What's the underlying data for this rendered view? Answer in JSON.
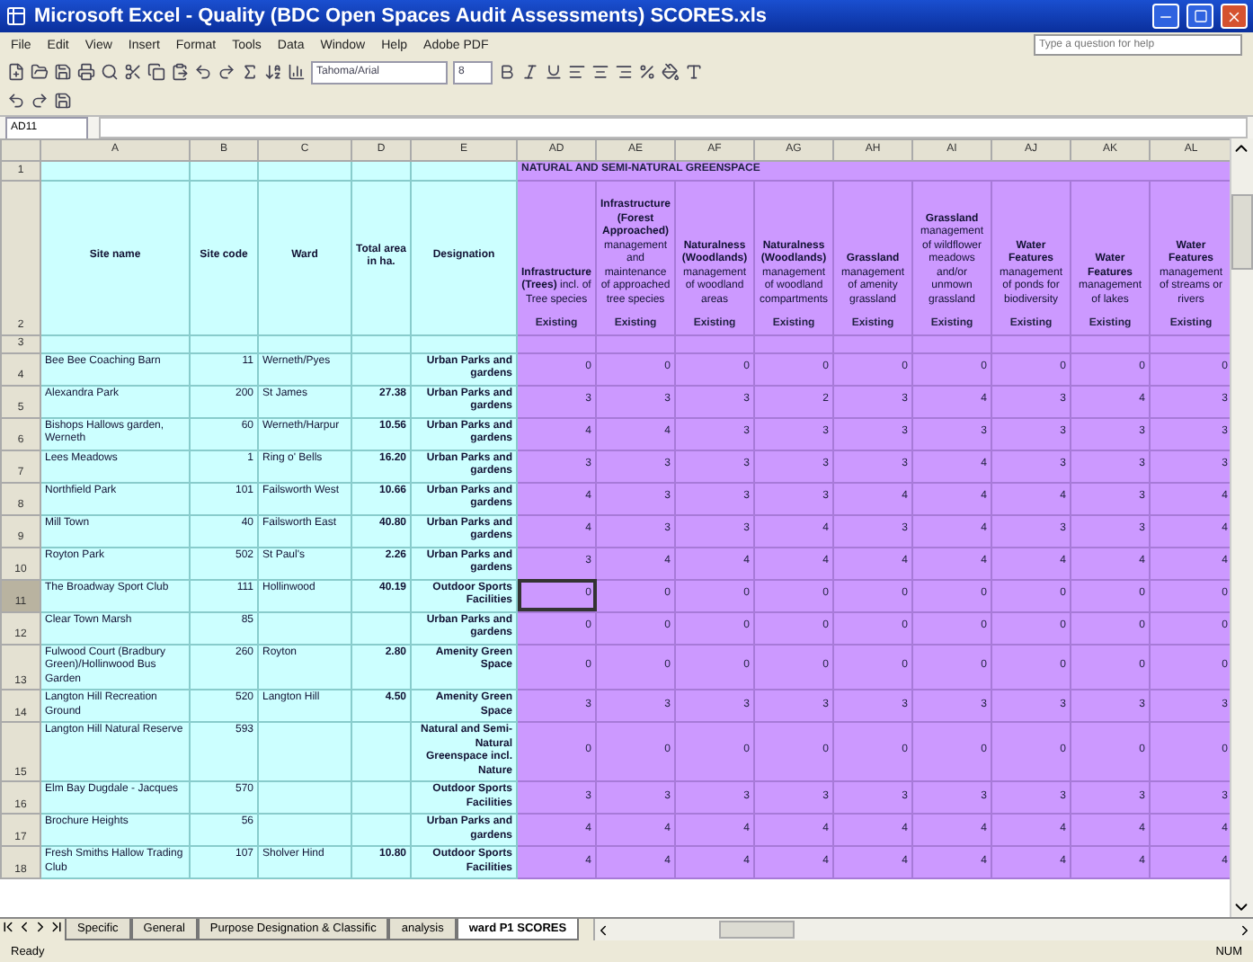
{
  "window": {
    "title": "Microsoft Excel - Quality (BDC Open Spaces Audit Assessments) SCORES.xls"
  },
  "menu": [
    "File",
    "Edit",
    "View",
    "Insert",
    "Format",
    "Tools",
    "Data",
    "Window",
    "Help",
    "Adobe PDF"
  ],
  "help_search": {
    "placeholder": "Type a question for help"
  },
  "font_box": {
    "value": "Tahoma/Arial"
  },
  "size_box": {
    "value": "8"
  },
  "name_box": {
    "value": "AD11"
  },
  "column_letters": [
    "A",
    "B",
    "C",
    "D",
    "E",
    "AD",
    "AE",
    "AF",
    "AG",
    "AH",
    "AI",
    "AJ",
    "AK",
    "AL"
  ],
  "header_row_numbers": [
    "1",
    "2",
    "3"
  ],
  "banner": "NATURAL AND SEMI-NATURAL GREENSPACE",
  "left_headers": [
    "Site name",
    "Site code",
    "Ward",
    "Total area in ha.",
    "Designation"
  ],
  "score_headers": [
    {
      "text": "**Infrastructure (Trees)** incl. of Tree species",
      "sub": "Existing"
    },
    {
      "text": "**Infrastructure (Forest Approached)** management and maintenance of approached tree species",
      "sub": "Existing"
    },
    {
      "text": "**Naturalness (Woodlands)** management of woodland areas",
      "sub": "Existing"
    },
    {
      "text": "**Naturalness (Woodlands)** management of woodland compartments",
      "sub": "Existing"
    },
    {
      "text": "**Grassland** management of amenity grassland",
      "sub": "Existing"
    },
    {
      "text": "**Grassland** management of wildflower meadows and/or unmown grassland",
      "sub": "Existing"
    },
    {
      "text": "**Water Features** management of ponds for biodiversity",
      "sub": "Existing"
    },
    {
      "text": "**Water Features** management of lakes",
      "sub": "Existing"
    },
    {
      "text": "**Water Features** management of streams or rivers",
      "sub": "Existing"
    }
  ],
  "rows": [
    {
      "number": "4",
      "site": "Bee Bee Coaching Barn",
      "code": "11",
      "ward": "Werneth/Pyes",
      "area": "",
      "designation": "Urban Parks and gardens",
      "selected": false,
      "scores": [
        "0",
        "0",
        "0",
        "0",
        "0",
        "0",
        "0",
        "0",
        "0"
      ]
    },
    {
      "number": "5",
      "site": "Alexandra Park",
      "code": "200",
      "ward": "St James",
      "area": "27.38",
      "designation": "Urban Parks and gardens",
      "selected": false,
      "scores": [
        "3",
        "3",
        "3",
        "2",
        "3",
        "4",
        "3",
        "4",
        "3"
      ]
    },
    {
      "number": "6",
      "site": "Bishops Hallows garden, Werneth",
      "code": "60",
      "ward": "Werneth/Harpur",
      "area": "10.56",
      "designation": "Urban Parks and gardens",
      "selected": false,
      "scores": [
        "4",
        "4",
        "3",
        "3",
        "3",
        "3",
        "3",
        "3",
        "3"
      ]
    },
    {
      "number": "7",
      "site": "Lees Meadows",
      "code": "1",
      "ward": "Ring o' Bells",
      "area": "16.20",
      "designation": "Urban Parks and gardens",
      "selected": false,
      "scores": [
        "3",
        "3",
        "3",
        "3",
        "3",
        "4",
        "3",
        "3",
        "3"
      ]
    },
    {
      "number": "8",
      "site": "Northfield Park",
      "code": "101",
      "ward": "Failsworth West",
      "area": "10.66",
      "designation": "Urban Parks and gardens",
      "selected": false,
      "scores": [
        "4",
        "3",
        "3",
        "3",
        "4",
        "4",
        "4",
        "3",
        "4"
      ]
    },
    {
      "number": "9",
      "site": "Mill Town",
      "code": "40",
      "ward": "Failsworth East",
      "area": "40.80",
      "designation": "Urban Parks and gardens",
      "selected": false,
      "scores": [
        "4",
        "3",
        "3",
        "4",
        "3",
        "4",
        "3",
        "3",
        "4"
      ]
    },
    {
      "number": "10",
      "site": "Royton Park",
      "code": "502",
      "ward": "St Paul's",
      "area": "2.26",
      "designation": "Urban Parks and gardens",
      "selected": false,
      "scores": [
        "3",
        "4",
        "4",
        "4",
        "4",
        "4",
        "4",
        "4",
        "4"
      ]
    },
    {
      "number": "11",
      "site": "The Broadway Sport Club",
      "code": "111",
      "ward": "Hollinwood",
      "area": "40.19",
      "designation": "Outdoor Sports Facilities",
      "selected": true,
      "scores": [
        "0",
        "0",
        "0",
        "0",
        "0",
        "0",
        "0",
        "0",
        "0"
      ]
    },
    {
      "number": "12",
      "site": "Clear Town Marsh",
      "code": "85",
      "ward": "",
      "area": "",
      "designation": "Urban Parks and gardens",
      "selected": false,
      "scores": [
        "0",
        "0",
        "0",
        "0",
        "0",
        "0",
        "0",
        "0",
        "0"
      ]
    },
    {
      "number": "13",
      "site": "Fulwood Court (Bradbury Green)/Hollinwood Bus Garden",
      "code": "260",
      "ward": "Royton",
      "area": "2.80",
      "designation": "Amenity Green Space",
      "selected": false,
      "scores": [
        "0",
        "0",
        "0",
        "0",
        "0",
        "0",
        "0",
        "0",
        "0"
      ]
    },
    {
      "number": "14",
      "site": "Langton Hill Recreation Ground",
      "code": "520",
      "ward": "Langton Hill",
      "area": "4.50",
      "designation": "Amenity Green Space",
      "selected": false,
      "scores": [
        "3",
        "3",
        "3",
        "3",
        "3",
        "3",
        "3",
        "3",
        "3"
      ]
    },
    {
      "number": "15",
      "site": "Langton Hill Natural Reserve",
      "code": "593",
      "ward": "",
      "area": "",
      "designation": "Natural and Semi-Natural Greenspace incl. Nature",
      "selected": false,
      "scores": [
        "0",
        "0",
        "0",
        "0",
        "0",
        "0",
        "0",
        "0",
        "0"
      ]
    },
    {
      "number": "16",
      "site": "Elm Bay Dugdale - Jacques",
      "code": "570",
      "ward": "",
      "area": "",
      "designation": "Outdoor Sports Facilities",
      "selected": false,
      "scores": [
        "3",
        "3",
        "3",
        "3",
        "3",
        "3",
        "3",
        "3",
        "3"
      ]
    },
    {
      "number": "17",
      "site": "Brochure Heights",
      "code": "56",
      "ward": "",
      "area": "",
      "designation": "Urban Parks and gardens",
      "selected": false,
      "scores": [
        "4",
        "4",
        "4",
        "4",
        "4",
        "4",
        "4",
        "4",
        "4"
      ]
    },
    {
      "number": "18",
      "site": "Fresh Smiths Hallow Trading Club",
      "code": "107",
      "ward": "Sholver Hind",
      "area": "10.80",
      "designation": "Outdoor Sports Facilities",
      "selected": false,
      "scores": [
        "4",
        "4",
        "4",
        "4",
        "4",
        "4",
        "4",
        "4",
        "4"
      ]
    }
  ],
  "sheet_tabs": [
    {
      "label": "Specific",
      "selected": false
    },
    {
      "label": "General",
      "selected": false
    },
    {
      "label": "Purpose Designation & Classific",
      "selected": false
    },
    {
      "label": "analysis",
      "selected": false
    },
    {
      "label": "ward P1 SCORES",
      "selected": true
    }
  ],
  "status": {
    "left": "Ready",
    "right": "NUM"
  }
}
